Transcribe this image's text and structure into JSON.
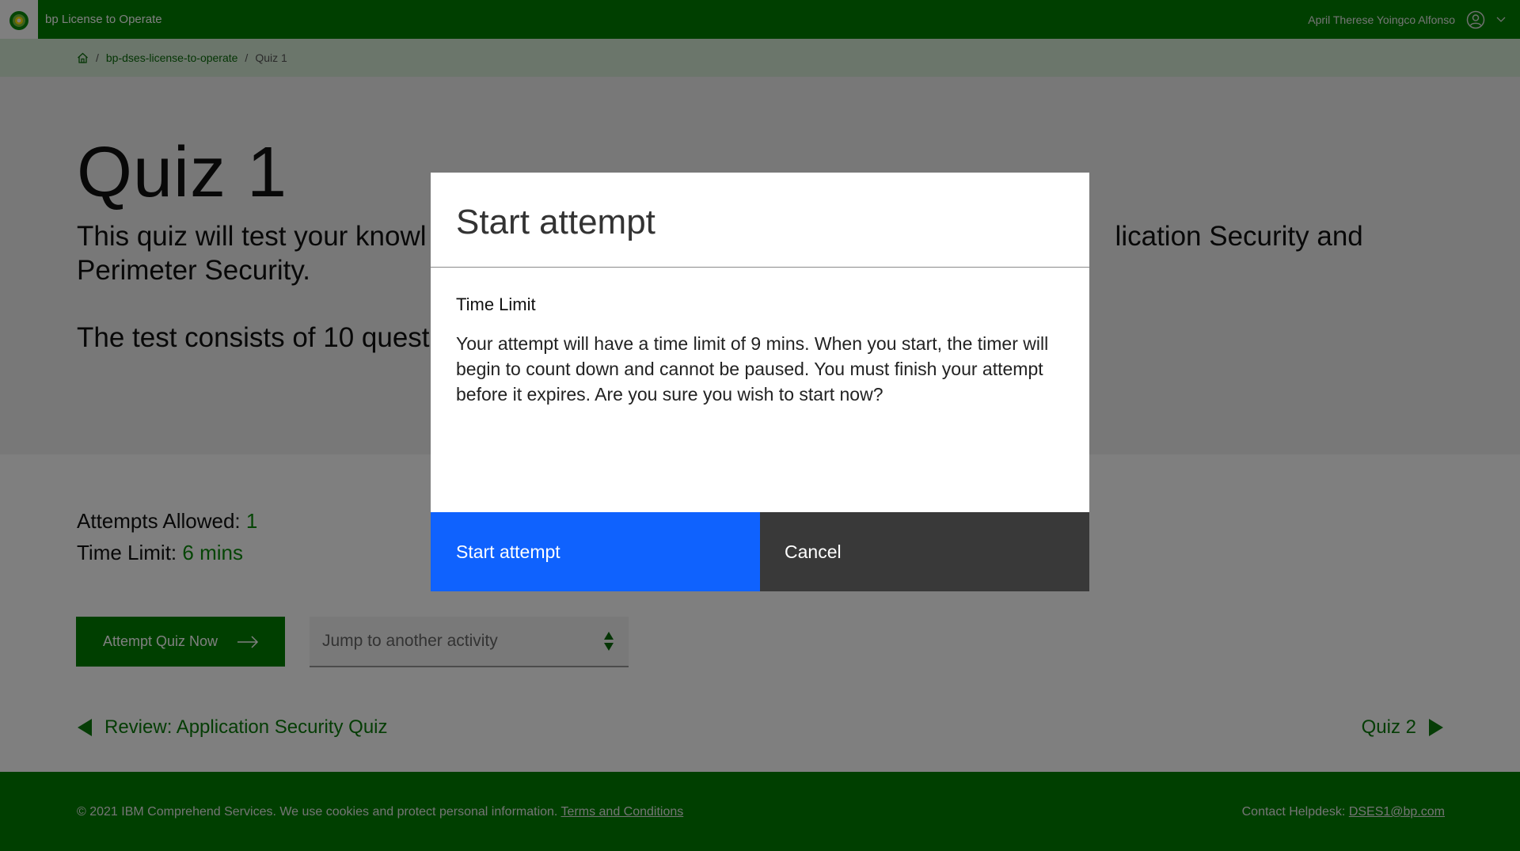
{
  "header": {
    "app_title": "bp License to Operate",
    "user_name": "April Therese Yoingco Alfonso"
  },
  "breadcrumb": {
    "items": [
      "bp-dses-license-to-operate",
      "Quiz 1"
    ],
    "separator": "/"
  },
  "hero": {
    "title": "Quiz 1",
    "description": "This quiz will test your knowledge of the topics covered in Application Security and Perimeter Security.",
    "visible_description_left": "This quiz will test your knowl",
    "visible_description_right": "lication Security and",
    "visible_description_line2": "Perimeter Security.",
    "test_info_visible": "The test consists of 10 quest"
  },
  "info": {
    "attempts_label": "Attempts Allowed:",
    "attempts_value": "1",
    "time_label": "Time Limit:",
    "time_value": "6 mins"
  },
  "actions": {
    "attempt_label": "Attempt Quiz Now",
    "jump_placeholder": "Jump to another activity"
  },
  "navigation": {
    "prev_label": "Review: Application Security Quiz",
    "next_label": "Quiz 2"
  },
  "footer": {
    "copyright": "© 2021 IBM Comprehend Services. We use cookies and protect personal information.",
    "terms_link": "Terms and Conditions",
    "helpdesk_label": "Contact Helpdesk:",
    "helpdesk_email": "DSES1@bp.com"
  },
  "modal": {
    "title": "Start attempt",
    "section_heading": "Time Limit",
    "message": "Your attempt will have a time limit of 9 mins. When you start, the timer will begin to count down and cannot be paused. You must finish your attempt before it expires. Are you sure you wish to start now?",
    "primary_label": "Start attempt",
    "secondary_label": "Cancel"
  },
  "colors": {
    "brand_green": "#007f00",
    "primary_blue": "#0f62fe",
    "secondary_dark": "#393939"
  }
}
